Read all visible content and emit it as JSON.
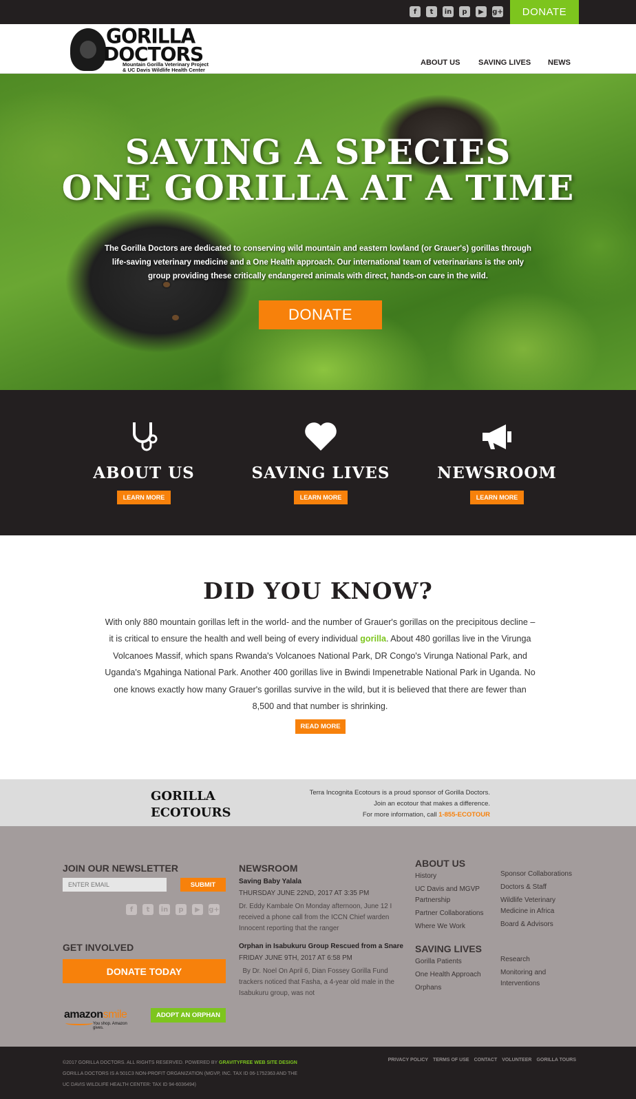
{
  "topbar": {
    "socials": [
      "facebook-icon",
      "twitter-icon",
      "linkedin-icon",
      "pinterest-icon",
      "youtube-icon",
      "google-plus-icon"
    ],
    "donate": "DONATE"
  },
  "logo": {
    "line1": "GORILLA",
    "line2": "DOCTORS",
    "sub1": "Mountain Gorilla Veterinary Project",
    "sub2": "& UC Davis Wildlife Health Center"
  },
  "nav": {
    "about": "ABOUT US",
    "saving": "SAVING LIVES",
    "news": "NEWS"
  },
  "hero": {
    "title1": "SAVING A SPECIES",
    "title2": "ONE GORILLA AT A TIME",
    "text": "The Gorilla Doctors are dedicated to conserving wild mountain and eastern lowland (or Grauer's) gorillas through life-saving veterinary medicine and a One Health approach. Our international team of veterinarians is the only group providing these critically endangered animals with direct, hands-on care in the wild.",
    "donate": "DONATE"
  },
  "features": [
    {
      "icon": "stethoscope-icon",
      "title": "ABOUT US",
      "button": "LEARN MORE"
    },
    {
      "icon": "heart-icon",
      "title": "SAVING LIVES",
      "button": "LEARN MORE"
    },
    {
      "icon": "megaphone-icon",
      "title": "NEWSROOM",
      "button": "LEARN MORE"
    }
  ],
  "did_you_know": {
    "title": "DID YOU KNOW?",
    "text_before": "With only 880 mountain gorillas left in the world- and the number of Grauer's gorillas on the precipitous decline – it is critical to ensure the health and well being of every individual ",
    "link": "gorilla",
    "text_after": ". About 480 gorillas live in the Virunga Volcanoes Massif, which spans Rwanda's Volcanoes National Park, DR Congo's Virunga National Park, and Uganda's Mgahinga National Park. Another 400 gorillas live in Bwindi Impenetrable National Park in Uganda. No one knows exactly how many Grauer's gorillas survive in the wild, but it is believed that there are fewer than 8,500 and that number is shrinking.",
    "button": "READ MORE"
  },
  "ecotours": {
    "logo1": "GORILLA",
    "logo2": "ECOTOURS",
    "line1": "Terra Incognita Ecotours is a proud sponsor of Gorilla Doctors.",
    "line2": "Join an ecotour that makes a difference.",
    "line3": "For more information, call ",
    "phone": "1-855-ECOTOUR"
  },
  "footer": {
    "newsletter": {
      "heading": "JOIN OUR NEWSLETTER",
      "placeholder": "ENTER EMAIL",
      "submit": "SUBMIT"
    },
    "get_involved": {
      "heading": "GET INVOLVED",
      "donate": "DONATE TODAY",
      "amazon": "amazon",
      "smile": "smile",
      "tagline": "You shop. Amazon gives.",
      "adopt": "ADOPT AN ORPHAN"
    },
    "newsroom": {
      "heading": "NEWSROOM",
      "items": [
        {
          "title": "Saving Baby Yalala",
          "date": "THURSDAY JUNE 22ND, 2017 AT 3:35 PM",
          "excerpt": "Dr. Eddy Kambale On Monday afternoon, June 12 I received a phone call from the ICCN Chief warden Innocent reporting that the ranger"
        },
        {
          "title": "Orphan in Isabukuru Group Rescued from a Snare",
          "date": "FRIDAY JUNE 9TH, 2017 AT 6:58 PM",
          "excerpt": "  By Dr. Noel On April 6, Dian Fossey Gorilla Fund trackers noticed that Fasha, a 4-year old male in the Isabukuru group, was not"
        }
      ]
    },
    "about": {
      "heading": "ABOUT US",
      "col1": [
        "History",
        "UC Davis and MGVP Partnership",
        "Partner Collaborations",
        "Where We Work"
      ],
      "col2": [
        "Sponsor Collaborations",
        "Doctors & Staff",
        "Wildlife Veterinary Medicine in Africa",
        "Board & Advisors"
      ]
    },
    "saving": {
      "heading": "SAVING LIVES",
      "col1": [
        "Gorilla Patients",
        "One Health Approach",
        "Orphans"
      ],
      "col2": [
        "Research",
        "Monitoring and Interventions"
      ]
    }
  },
  "bottom": {
    "copy1": "©2017 GORILLA DOCTORS. ALL RIGHTS RESERVED. POWERED BY ",
    "gf": "GRAVITYFREE WEB SITE DESIGN",
    "copy2": "GORILLA DOCTORS IS A 501C3 NON-PROFIT ORGANIZATION (MGVP, INC. TAX ID 06-1752363 AND THE",
    "copy3": "UC DAVIS WILDLIFE HEALTH CENTER: TAX ID 94-6036494)",
    "links": [
      "PRIVACY POLICY",
      "TERMS OF USE",
      "CONTACT",
      "VOLUNTEER",
      "GORILLA TOURS"
    ]
  },
  "colors": {
    "orange": "#f7810b",
    "green": "#7dc51e",
    "dark": "#231f20",
    "footer": "#a39c9c"
  }
}
